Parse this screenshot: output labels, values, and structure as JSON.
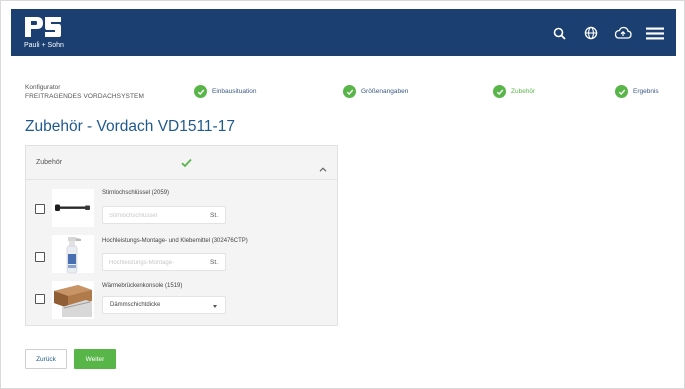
{
  "brand": {
    "logo_text": "PS",
    "tagline": "Pauli + Sohn",
    "header_color": "#1b3f70"
  },
  "header_icons": [
    "search-icon",
    "globe-icon",
    "cloud-upload-icon",
    "menu-icon"
  ],
  "breadcrumb": {
    "label": "Konfigurator",
    "product": "FREITRAGENDES VORDACHSYSTEM"
  },
  "steps": [
    {
      "label": "Einbausituation",
      "done": true
    },
    {
      "label": "Größenangaben",
      "done": true
    },
    {
      "label": "Zubehör",
      "done": true,
      "active": true
    },
    {
      "label": "Ergebnis",
      "done": true
    }
  ],
  "page_title": "Zubehör - Vordach VD1511-17",
  "accordion": {
    "title": "Zubehör",
    "items": [
      {
        "name": "Stirnlochschlüssel (2059)",
        "placeholder": "Stirnlochschlüssel",
        "unit": "St.",
        "checked": false
      },
      {
        "name": "Hochleistungs-Montage- und Klebemittel (302476CTP)",
        "placeholder": "Hochleistungs-Montage-",
        "unit": "St.",
        "checked": false
      },
      {
        "name": "Wärmebrückenkonsole (1519)",
        "select_value": "Dämmschichtdicke",
        "checked": false
      }
    ]
  },
  "buttons": {
    "back": "Zurück",
    "next": "Weiter"
  },
  "colors": {
    "accent_green": "#58b548",
    "title_blue": "#1f5a8e"
  }
}
